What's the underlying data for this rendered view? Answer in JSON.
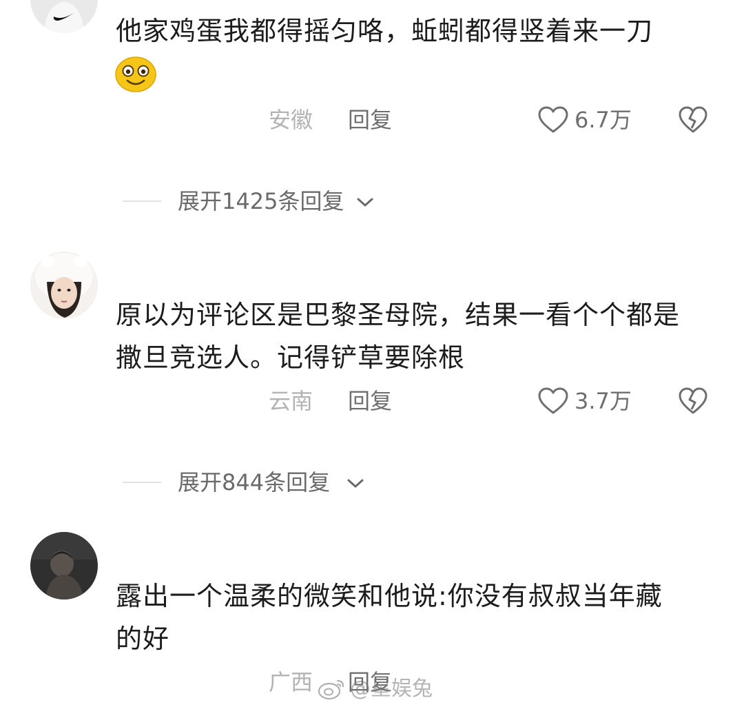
{
  "comments": [
    {
      "text": "他家鸡蛋我都得摇匀咯，蚯蚓都得竖着来一刀",
      "location": "安徽",
      "reply_label": "回复",
      "likes": "6.7万",
      "expand_label": "展开1425条回复"
    },
    {
      "text_line1": "原以为评论区是巴黎圣母院，结果一看个个都是",
      "text_line2": "撒旦竞选人。记得铲草要除根",
      "location": "云南",
      "reply_label": "回复",
      "likes": "3.7万",
      "expand_label": "展开844条回复"
    },
    {
      "text_line1": "露出一个温柔的微笑和他说:你没有叔叔当年藏",
      "text_line2": "的好",
      "location": "广西",
      "reply_label": "回复"
    }
  ],
  "watermark": {
    "text": "@星娱兔",
    "icon": "weibo-icon"
  },
  "icons": {
    "emoji": "smiley-emoji-icon",
    "like": "heart-outline-icon",
    "dislike": "broken-heart-icon",
    "expand": "chevron-down-icon"
  },
  "colors": {
    "primary_text": "#1c1c1c",
    "meta_text": "#6e6e6e",
    "location_text": "#b3b3b3",
    "emoji_yellow": "#f5c518"
  }
}
